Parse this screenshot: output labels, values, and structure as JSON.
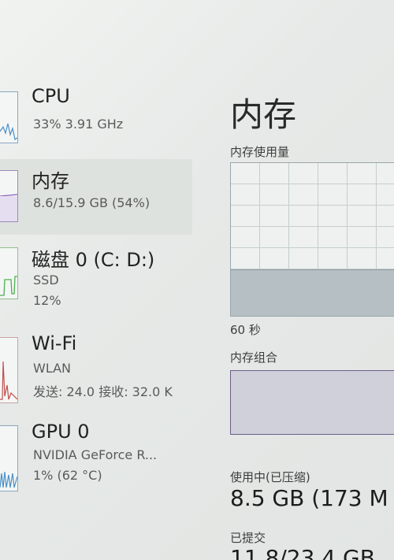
{
  "sidebar": {
    "items": [
      {
        "title": "CPU",
        "lines": [
          "33% 3.91 GHz"
        ]
      },
      {
        "title": "内存",
        "lines": [
          "8.6/15.9 GB (54%)"
        ]
      },
      {
        "title": "磁盘 0 (C: D:)",
        "lines": [
          "SSD",
          "12%"
        ]
      },
      {
        "title": "Wi-Fi",
        "lines": [
          "WLAN",
          "发送: 24.0 接收: 32.0 K"
        ]
      },
      {
        "title": "GPU 0",
        "lines": [
          "NVIDIA GeForce R...",
          "1% (62 °C)"
        ]
      }
    ],
    "selected_index": 1
  },
  "memory_pane": {
    "title": "内存",
    "usage_label": "内存使用量",
    "usage_fraction": 0.54,
    "time_label": "60 秒",
    "composition_label": "内存组合",
    "in_use_label": "使用中(已压缩)",
    "in_use_value": "8.5 GB (173 M",
    "committed_label": "已提交",
    "committed_value": "11.8/23.4 GB"
  },
  "colors": {
    "accent_cpu": "#4a8fc8",
    "accent_memory": "#8b5fbf",
    "accent_disk": "#4caf50",
    "accent_wifi": "#c0504d",
    "accent_gpu": "#4a8fc8"
  }
}
